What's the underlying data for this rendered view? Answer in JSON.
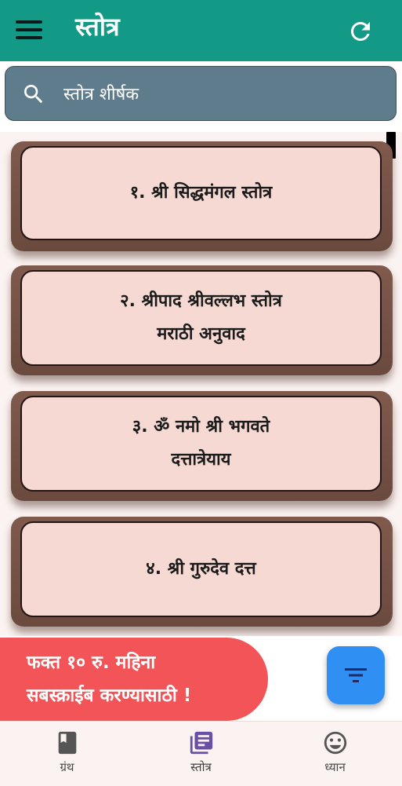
{
  "app": {
    "title": "स्तोत्र",
    "colors": {
      "primary": "#139a87",
      "search_bg": "#5f7c8c",
      "card_bg": "#f5d9d2",
      "card_shadow": "#7f5a4d",
      "banner": "#f25457",
      "fab": "#2f8ff2",
      "active_nav_icon": "#6a4fa6"
    }
  },
  "header": {
    "menu_icon": "hamburger-menu-icon",
    "refresh_icon": "refresh-icon"
  },
  "search": {
    "placeholder": "स्तोत्र शीर्षक",
    "value": "",
    "icon": "search-icon"
  },
  "list": {
    "items": [
      {
        "title": "१. श्री सिद्धमंगल स्तोत्र"
      },
      {
        "title": "२. श्रीपाद श्रीवल्लभ स्तोत्र\nमराठी अनुवाद"
      },
      {
        "title": "३. ॐ नमो श्री भगवते\nदत्तात्रेयाय"
      },
      {
        "title": "४. श्री गुरुदेव दत्त"
      }
    ]
  },
  "banner": {
    "line1": "फक्त १० रु. महिना",
    "line2": "सबस्क्राईब करण्यासाठी !"
  },
  "fab": {
    "icon": "sort-filter-icon"
  },
  "bottom_nav": {
    "items": [
      {
        "label": "ग्रंथ",
        "icon": "book-icon",
        "active": false
      },
      {
        "label": "स्तोत्र",
        "icon": "library-books-icon",
        "active": true
      },
      {
        "label": "ध्यान",
        "icon": "smile-icon",
        "active": false
      }
    ]
  }
}
